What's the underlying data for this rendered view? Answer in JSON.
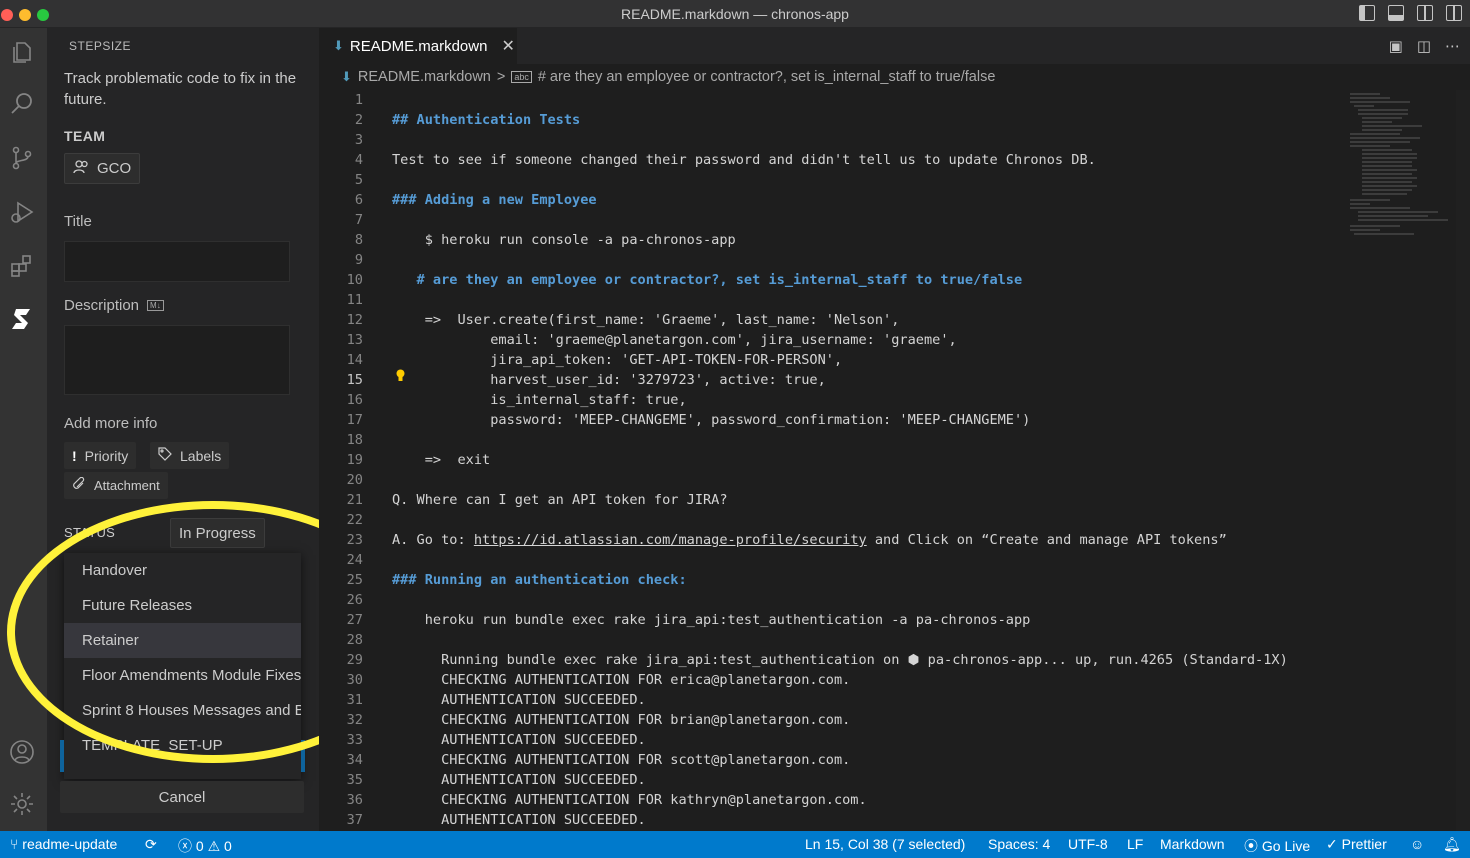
{
  "window": {
    "title": "README.markdown — chronos-app"
  },
  "activity_bar": {
    "icons": [
      "files-icon",
      "search-icon",
      "source-control-icon",
      "run-debug-icon",
      "extensions-icon",
      "stepsize-icon",
      "account-icon",
      "settings-gear-icon"
    ]
  },
  "side_panel": {
    "header": "STEPSIZE",
    "description": "Track problematic code to fix in the future.",
    "team_label": "TEAM",
    "team_value": "GCO",
    "title_label": "Title",
    "title_value": "",
    "description_label": "Description",
    "description_badge": "M↓",
    "description_value": "",
    "add_more_info_label": "Add more info",
    "priority_label": "Priority",
    "labels_label": "Labels",
    "attachment_label": "Attachment",
    "status_label": "STATUS",
    "status_value": "In Progress",
    "dropdown_items": [
      "Handover",
      "Future Releases",
      "Retainer",
      "Floor Amendments Module Fixes",
      "Sprint 8 Houses Messages and B",
      "TEMPLATE_SET-UP"
    ],
    "dropdown_active_index": 2,
    "cancel_label": "Cancel",
    "highlight_color": "#fff23a"
  },
  "editor": {
    "tab_label": "README.markdown",
    "breadcrumb_file": "README.markdown",
    "breadcrumb_separator": ">",
    "breadcrumb_symbol": "# are they an employee or contractor?, set is_internal_staff to true/false",
    "current_line": 15,
    "lines": [
      {
        "n": "1",
        "text": ""
      },
      {
        "n": "2",
        "text": "## Authentication Tests",
        "kind": "heading"
      },
      {
        "n": "3",
        "text": ""
      },
      {
        "n": "4",
        "text": "Test to see if someone changed their password and didn't tell us to update Chronos DB."
      },
      {
        "n": "5",
        "text": ""
      },
      {
        "n": "6",
        "text": "### Adding a new Employee",
        "kind": "heading"
      },
      {
        "n": "7",
        "text": ""
      },
      {
        "n": "8",
        "text": "    $ heroku run console -a pa-chronos-app"
      },
      {
        "n": "9",
        "text": ""
      },
      {
        "n": "10",
        "text": "   # are they an employee or contractor?, set is_internal_staff to true/false",
        "kind": "heading"
      },
      {
        "n": "11",
        "text": ""
      },
      {
        "n": "12",
        "text": "    =>  User.create(first_name: 'Graeme', last_name: 'Nelson',"
      },
      {
        "n": "13",
        "text": "            email: 'graeme@planetargon.com', jira_username: 'graeme',"
      },
      {
        "n": "14",
        "text": "            jira_api_token: 'GET-API-TOKEN-FOR-PERSON',"
      },
      {
        "n": "15",
        "text": "            harvest_user_id: '3279723', active: true,"
      },
      {
        "n": "16",
        "text": "            is_internal_staff: true,"
      },
      {
        "n": "17",
        "text": "            password: 'MEEP-CHANGEME', password_confirmation: 'MEEP-CHANGEME')"
      },
      {
        "n": "18",
        "text": ""
      },
      {
        "n": "19",
        "text": "    =>  exit"
      },
      {
        "n": "20",
        "text": ""
      },
      {
        "n": "21",
        "text": "Q. Where can I get an API token for JIRA?"
      },
      {
        "n": "22",
        "text": ""
      },
      {
        "n": "23",
        "text": "A. Go to: ",
        "link": "https://id.atlassian.com/manage-profile/security",
        "after": " and Click on “Create and manage API tokens”"
      },
      {
        "n": "24",
        "text": ""
      },
      {
        "n": "25",
        "text": "### Running an authentication check:",
        "kind": "heading"
      },
      {
        "n": "26",
        "text": ""
      },
      {
        "n": "27",
        "text": "    heroku run bundle exec rake jira_api:test_authentication -a pa-chronos-app"
      },
      {
        "n": "28",
        "text": ""
      },
      {
        "n": "29",
        "text": "      Running bundle exec rake jira_api:test_authentication on ⬢ pa-chronos-app... up, run.4265 (Standard-1X)"
      },
      {
        "n": "30",
        "text": "      CHECKING AUTHENTICATION FOR erica@planetargon.com."
      },
      {
        "n": "31",
        "text": "      AUTHENTICATION SUCCEEDED."
      },
      {
        "n": "32",
        "text": "      CHECKING AUTHENTICATION FOR brian@planetargon.com."
      },
      {
        "n": "33",
        "text": "      AUTHENTICATION SUCCEEDED."
      },
      {
        "n": "34",
        "text": "      CHECKING AUTHENTICATION FOR scott@planetargon.com."
      },
      {
        "n": "35",
        "text": "      AUTHENTICATION SUCCEEDED."
      },
      {
        "n": "36",
        "text": "      CHECKING AUTHENTICATION FOR kathryn@planetargon.com."
      },
      {
        "n": "37",
        "text": "      AUTHENTICATION SUCCEEDED."
      }
    ]
  },
  "status_bar": {
    "branch": "readme-update",
    "errors": "0",
    "warnings": "0",
    "cursor": "Ln 15, Col 38 (7 selected)",
    "spaces": "Spaces: 4",
    "encoding": "UTF-8",
    "eol": "LF",
    "language": "Markdown",
    "go_live": "Go Live",
    "prettier": "Prettier",
    "background": "#007acc"
  }
}
